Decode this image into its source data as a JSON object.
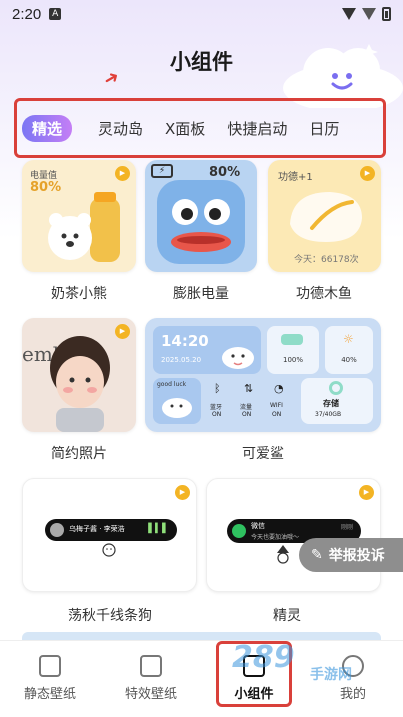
{
  "status": {
    "time": "2:20",
    "app_badge": "A"
  },
  "header": {
    "title": "小组件"
  },
  "tabs": [
    {
      "label": "精选"
    },
    {
      "label": "灵动岛"
    },
    {
      "label": "X面板"
    },
    {
      "label": "快捷启动"
    },
    {
      "label": "日历"
    }
  ],
  "widgets": {
    "milk_tea": {
      "name": "奶茶小熊",
      "power_label": "电量值",
      "power": "80%"
    },
    "battery": {
      "name": "膨胀电量",
      "percent": "80%"
    },
    "muyu": {
      "name": "功德木鱼",
      "merit": "功德+1",
      "today": "今天：66178次"
    },
    "photo": {
      "name": "简约照片",
      "photo_text": "emb"
    },
    "shark": {
      "name": "可爱鲨",
      "time": "14:20",
      "date": "2025.05.20",
      "battery": "100%",
      "brightness": "40%",
      "greeting": "good luck",
      "bluetooth": "蓝牙",
      "bluetooth_state": "ON",
      "data": "流量",
      "data_state": "ON",
      "wifi": "WIFI",
      "wifi_state": "ON",
      "storage": "存储",
      "storage_value": "37/40GB"
    },
    "dog": {
      "name": "荡秋千线条狗",
      "track": "乌梅子酱 · 李荣浩"
    },
    "spirit": {
      "name": "精灵",
      "app": "微信",
      "message": "今天也要加油哦～",
      "time": "刚刚"
    }
  },
  "report": {
    "label": "举报投诉"
  },
  "nav": {
    "items": [
      {
        "label": "静态壁纸"
      },
      {
        "label": "特效壁纸"
      },
      {
        "label": "小组件"
      },
      {
        "label": "我的"
      }
    ]
  },
  "watermark": {
    "brand": "289",
    "suffix": "手游网"
  },
  "colors": {
    "accent": "#8a7af5",
    "highlight": "#d9403a",
    "yellow": "#f3b424"
  }
}
